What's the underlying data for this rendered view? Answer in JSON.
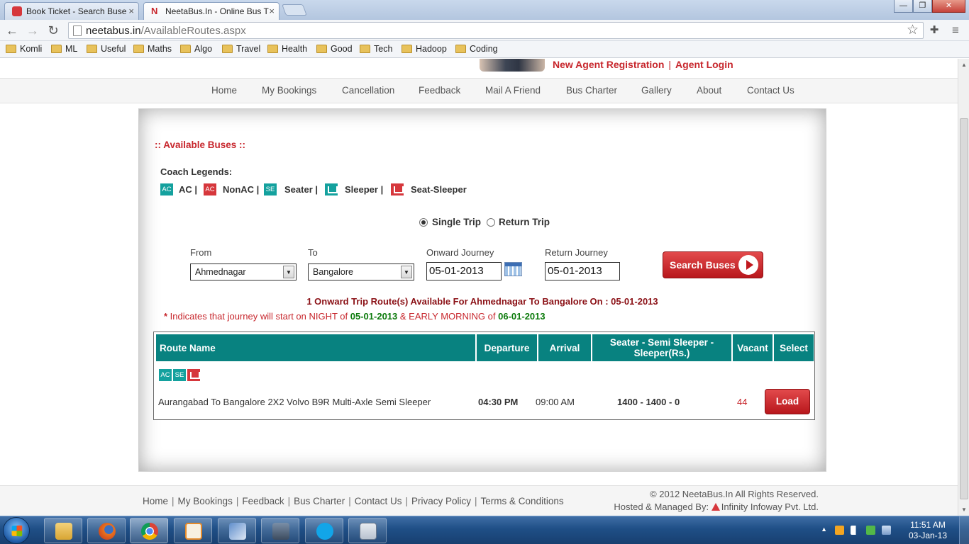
{
  "browser": {
    "tabs": [
      {
        "title": "Book Ticket - Search Buse",
        "close": "×"
      },
      {
        "title": "NeetaBus.In - Online Bus T",
        "close": "×"
      }
    ],
    "window_controls": {
      "minimize": "—",
      "maximize": "❐",
      "close": "✕"
    },
    "url_host": "neetabus.in",
    "url_path": "/AvailableRoutes.aspx",
    "nav": {
      "back": "←",
      "forward": "→",
      "reload": "↻",
      "star": "☆",
      "extensions": "✚",
      "menu": "≡"
    },
    "bookmarks": [
      "Komli",
      "ML",
      "Useful",
      "Maths",
      "Algo",
      "Travel",
      "Health",
      "Good",
      "Tech",
      "Hadoop",
      "Coding"
    ]
  },
  "header": {
    "new_agent": "New Agent Registration",
    "separator": "|",
    "agent_login": "Agent Login"
  },
  "main_nav": [
    "Home",
    "My Bookings",
    "Cancellation",
    "Feedback",
    "Mail A Friend",
    "Bus Charter",
    "Gallery",
    "About",
    "Contact Us"
  ],
  "available": {
    "title": ":: Available Buses ::",
    "legend_title": "Coach Legends:",
    "legends": [
      {
        "icon_text": "AC",
        "label": "AC |",
        "color": "#14a19e"
      },
      {
        "icon_text": "AC",
        "label": "NonAC |",
        "color": "#d6373c"
      },
      {
        "icon_text": "SE",
        "label": "Seater |",
        "color": "#14a19e"
      },
      {
        "icon_text": "",
        "label": "Sleeper |",
        "color": "#14a19e"
      },
      {
        "icon_text": "",
        "label": "Seat-Sleeper",
        "color": "#d6373c"
      }
    ]
  },
  "trip": {
    "single": "Single Trip",
    "return": "Return Trip",
    "selected": "single"
  },
  "form": {
    "from_label": "From",
    "from_value": "Ahmednagar",
    "to_label": "To",
    "to_value": "Bangalore",
    "onward_label": "Onward Journey",
    "onward_value": "05-01-2013",
    "return_label": "Return Journey",
    "return_value": "05-01-2013",
    "search_button": "Search Buses"
  },
  "results": {
    "summary": "1 Onward Trip Route(s) Available For Ahmednagar To Bangalore On : 05-01-2013",
    "note_star": "*",
    "note_prefix": " Indicates that journey will start on NIGHT of ",
    "note_date1": "05-01-2013",
    "note_mid": " & EARLY MORNING of ",
    "note_date2": "06-01-2013"
  },
  "table": {
    "headers": [
      "Route Name",
      "Departure",
      "Arrival",
      "Seater - Semi Sleeper - Sleeper(Rs.)",
      "Vacant",
      "Select"
    ],
    "rows": [
      {
        "icons": [
          {
            "text": "AC",
            "color": "#14a19e"
          },
          {
            "text": "SE",
            "color": "#14a19e"
          },
          {
            "text": "",
            "color": "#d6373c"
          }
        ],
        "route_name": "Aurangabad To Bangalore 2X2 Volvo B9R Multi-Axle Semi Sleeper",
        "departure": "04:30 PM",
        "arrival": "09:00 AM",
        "fare": "1400 - 1400 - 0",
        "vacant": "44",
        "select_button": "Load"
      }
    ]
  },
  "footer": {
    "links": [
      "Home",
      "My Bookings",
      "Feedback",
      "Bus Charter",
      "Contact Us",
      "Privacy Policy",
      "Terms & Conditions"
    ],
    "link_separator": "|",
    "copyright": "© 2012 NeetaBus.In All Rights Reserved.",
    "hosted_prefix": "Hosted & Managed By:",
    "hosted_company": "Infinity Infoway Pvt. Ltd."
  },
  "taskbar": {
    "time": "11:51 AM",
    "date": "03-Jan-13",
    "tray_arrow": "▲"
  },
  "colors": {
    "brand_red": "#c7262c",
    "table_header_teal": "#088280",
    "legend_teal": "#14a19e",
    "legend_red": "#d6373c",
    "date_green": "#0b7a0b"
  }
}
